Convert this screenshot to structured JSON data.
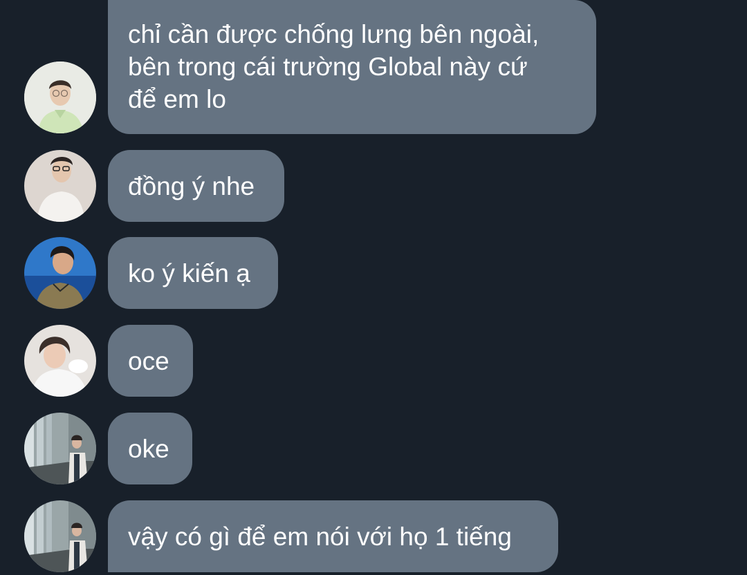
{
  "messages": [
    {
      "text": "chỉ cần được chống lưng bên ngoài,\nbên trong cái trường Global này cứ\nđể em lo",
      "avatar": "avatar-green-shirt"
    },
    {
      "text": "đồng ý nhe",
      "avatar": "avatar-white-shirt-glasses"
    },
    {
      "text": "ko ý kiến ạ",
      "avatar": "avatar-ocean-background"
    },
    {
      "text": "oce",
      "avatar": "avatar-white-sweater"
    },
    {
      "text": "oke",
      "avatar": "avatar-corridor"
    },
    {
      "text": "vậy có gì để em nói với họ 1 tiếng",
      "avatar": "avatar-corridor"
    }
  ],
  "colors": {
    "background": "#18202a",
    "bubble": "#657382",
    "text": "#ffffff"
  }
}
